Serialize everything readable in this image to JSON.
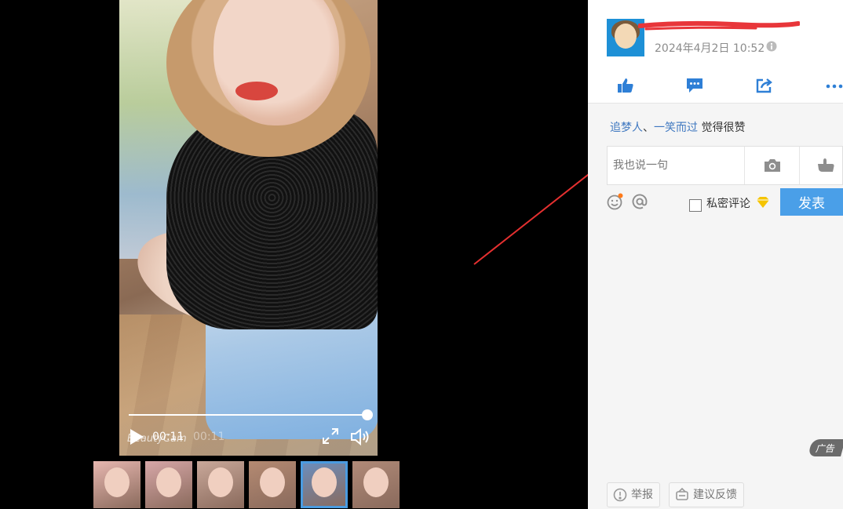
{
  "video": {
    "current_time": "00:11",
    "duration": "00:11",
    "progress": 1.0,
    "watermark": "BeautyCam"
  },
  "thumbnails": {
    "count": 6,
    "active_index": 4,
    "tones": [
      "#e7b7b0",
      "#d7a7a8",
      "#c9a89a",
      "#b48a72",
      "#6a8fc0",
      "#b08a78"
    ]
  },
  "post": {
    "time": "2024年4月2日 10:52"
  },
  "likes": {
    "users": [
      "追梦人",
      "一笑而过"
    ],
    "separator": "、",
    "suffix": "觉得很赞"
  },
  "comment": {
    "placeholder": "我也说一句",
    "private_label": "私密评论",
    "submit_label": "发表"
  },
  "ad": {
    "label": "广告"
  },
  "footer": {
    "report_label": "举报",
    "feedback_label": "建议反馈"
  },
  "colors": {
    "accent": "#4a9fe8",
    "link": "#3f78c0",
    "icon": "#2e7fd6",
    "annotation": "#e53030"
  },
  "icons": {
    "like": "thumbs-up-icon",
    "comment": "comment-icon",
    "share": "share-icon",
    "more": "more-dots-icon",
    "photo": "camera-icon",
    "hand": "pointing-hand-icon",
    "emoji": "smiley-icon",
    "at": "at-sign-icon",
    "vip": "diamond-icon",
    "report": "report-icon",
    "feedback": "feedback-icon"
  }
}
